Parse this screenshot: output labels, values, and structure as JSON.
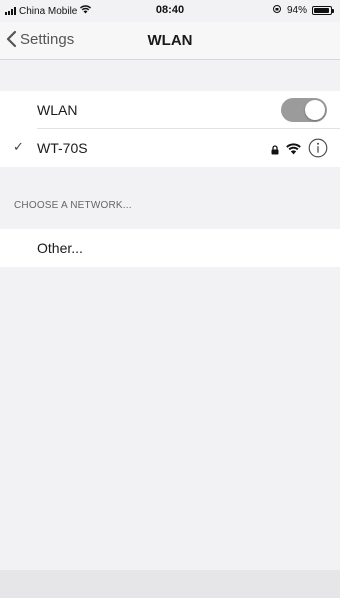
{
  "status_bar": {
    "carrier": "China Mobile",
    "time": "08:40",
    "battery": "94%",
    "battery_level": 0.94,
    "icons": [
      "signal-icon",
      "wifi-icon",
      "orientation-lock-icon",
      "battery-icon"
    ]
  },
  "nav": {
    "back_label": "Settings",
    "title": "WLAN"
  },
  "wlan_group": {
    "toggle_label": "WLAN",
    "toggle_on": true,
    "connected_network": "WT-70S",
    "connected_icons": [
      "checkmark-icon",
      "lock-icon",
      "wifi-icon",
      "info-icon"
    ]
  },
  "networks": {
    "section_header": "CHOOSE A NETWORK...",
    "other_label": "Other..."
  },
  "colors": {
    "background": "#f2f2f4",
    "toggle_track": "#9b9b9b",
    "text": "#1a1a1a",
    "secondary_text": "#666666"
  }
}
